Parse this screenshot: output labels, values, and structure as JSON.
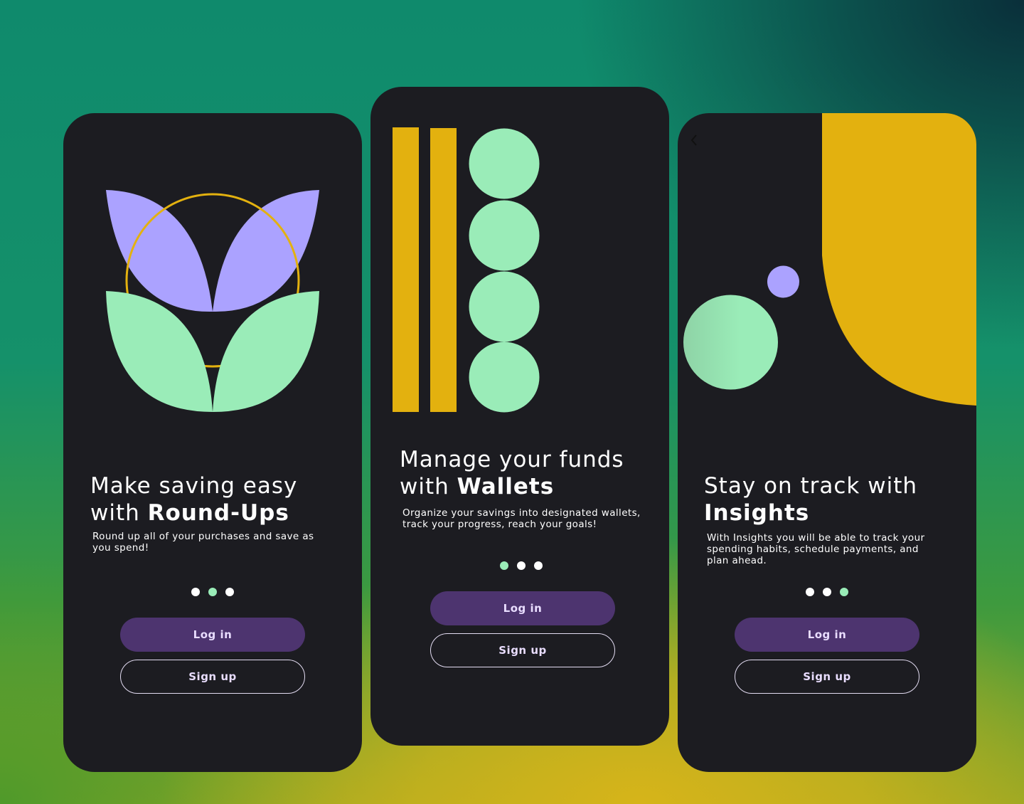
{
  "colors": {
    "card_bg": "#1c1c21",
    "lavender": "#aba2ff",
    "mint": "#9aecb8",
    "gold": "#e3b10f",
    "button_purple": "#4d346f",
    "button_text": "#e9ddff"
  },
  "screens": [
    {
      "heading_line1": "Make saving easy",
      "heading_prefix": "with ",
      "heading_bold": "Round-Ups",
      "subtitle": "Round up all of your purchases and save as you spend!",
      "active_dot": 1,
      "login_label": "Log in",
      "signup_label": "Sign up"
    },
    {
      "heading_line1": "Manage your funds",
      "heading_prefix": "with ",
      "heading_bold": "Wallets",
      "subtitle": "Organize your savings into designated wallets, track your progress, reach your goals!",
      "active_dot": 0,
      "login_label": "Log in",
      "signup_label": "Sign up"
    },
    {
      "heading_line1": "Stay on track with",
      "heading_prefix": "",
      "heading_bold": "Insights",
      "subtitle": "With Insights you will be able to track your spending habits, schedule payments, and plan ahead.",
      "active_dot": 2,
      "back_icon": "chevron-left-icon",
      "login_label": "Log in",
      "signup_label": "Sign up"
    }
  ]
}
